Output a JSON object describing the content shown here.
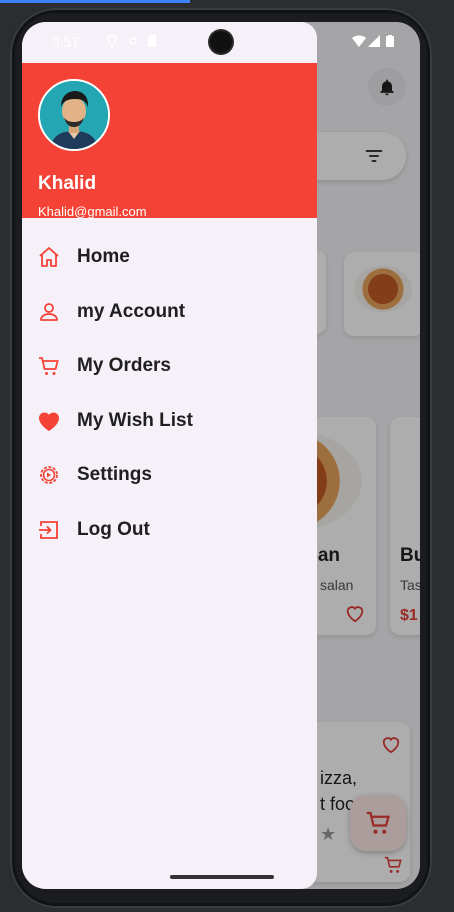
{
  "status_bar": {
    "time": "3:57"
  },
  "user": {
    "name": "Khalid",
    "email": "Khalid@gmail.com"
  },
  "menu": [
    {
      "label": "Home",
      "icon": "home-icon"
    },
    {
      "label": "my Account",
      "icon": "person-icon"
    },
    {
      "label": "My Orders",
      "icon": "cart-icon"
    },
    {
      "label": "My Wish List",
      "icon": "heart-icon"
    },
    {
      "label": "Settings",
      "icon": "settings-icon"
    },
    {
      "label": "Log Out",
      "icon": "logout-icon"
    }
  ],
  "background": {
    "card1": {
      "title": "alan",
      "subtitle": "salan"
    },
    "card2": {
      "title": "Bu",
      "subtitle": "Tas",
      "price": "$1"
    },
    "promo": {
      "line1": "izza,",
      "line2": "t foo"
    }
  },
  "colors": {
    "accent": "#f44336",
    "drawer_bg": "#f6f1f8"
  }
}
